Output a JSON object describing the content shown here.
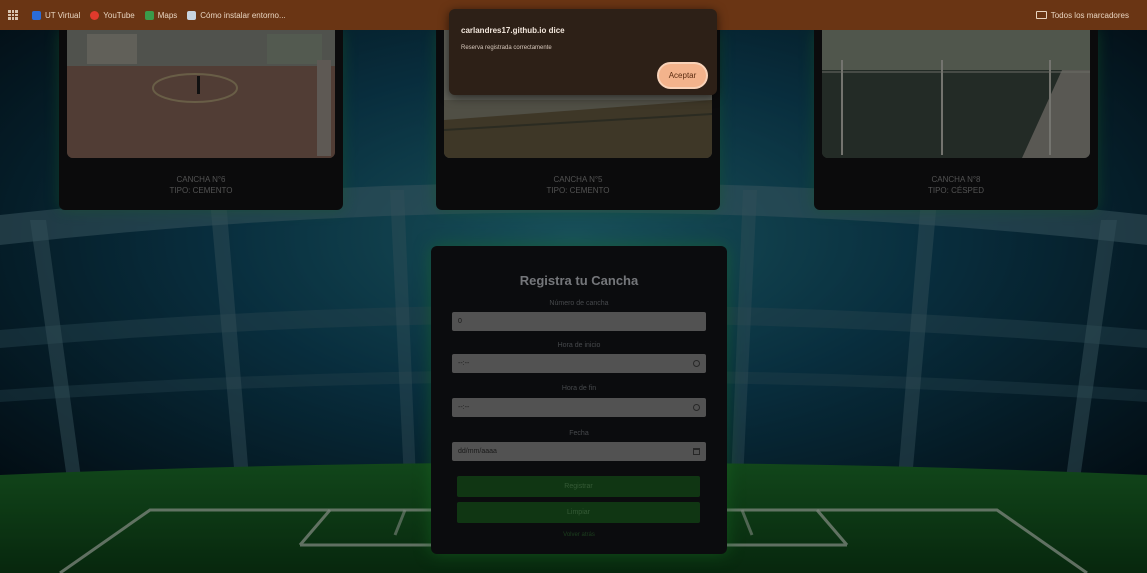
{
  "bookmarks": {
    "items": [
      {
        "label": "UT Virtual",
        "color": "#2b6cd9"
      },
      {
        "label": "YouTube",
        "color": "#e03a2c"
      },
      {
        "label": "Maps",
        "color": "#3a9b4a"
      },
      {
        "label": "Cómo instalar entorno...",
        "color": "#c8d4e0"
      }
    ],
    "all_bookmarks": "Todos los marcadores"
  },
  "cards": [
    {
      "name": "CANCHA N°6",
      "type": "TIPO: CEMENTO"
    },
    {
      "name": "CANCHA N°5",
      "type": "TIPO: CEMENTO"
    },
    {
      "name": "CANCHA N°8",
      "type": "TIPO: CÉSPED"
    }
  ],
  "form": {
    "title": "Registra tu Cancha",
    "fields": [
      {
        "label": "Número de cancha",
        "value": "0"
      },
      {
        "label": "Hora de inicio",
        "value": "--:--"
      },
      {
        "label": "Hora de fin",
        "value": "--:--"
      },
      {
        "label": "Fecha",
        "value": "dd/mm/aaaa"
      }
    ],
    "buttons": [
      "Registrar",
      "Limpiar"
    ],
    "link": "Volver atrás"
  },
  "dialog": {
    "title": "carlandres17.github.io dice",
    "message": "Reserva registrada correctamente",
    "ok_label": "Aceptar"
  },
  "colors": {
    "bookmark_bar": "#6a3514",
    "dialog_bg": "#2d2017",
    "dialog_button": "#f3b38c",
    "form_button": "#1d5e22",
    "glow": "#28b43c"
  }
}
